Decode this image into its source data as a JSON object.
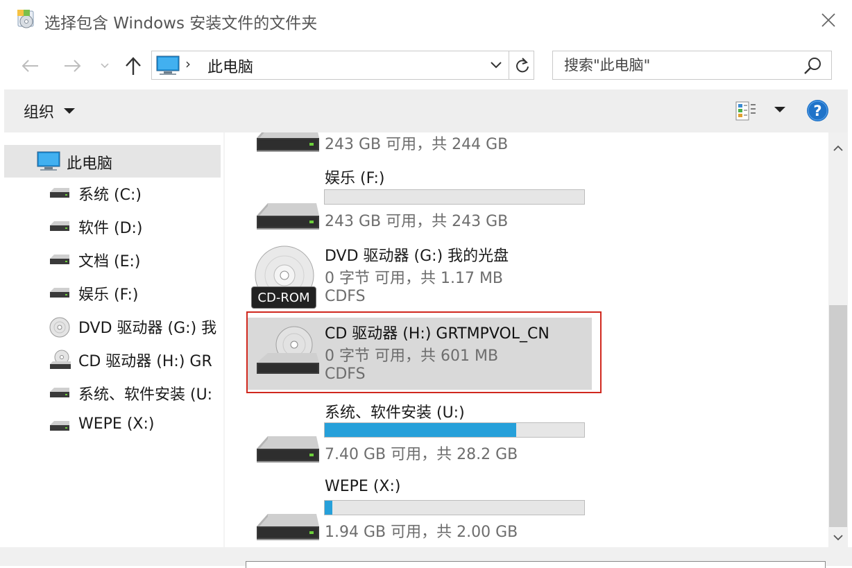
{
  "window": {
    "title": "选择包含 Windows 安装文件的文件夹"
  },
  "nav": {
    "address": "此电脑",
    "search_placeholder": "搜索\"此电脑\""
  },
  "toolbar": {
    "organize_label": "组织"
  },
  "sidebar": {
    "root_label": "此电脑",
    "items": [
      {
        "label": "系统 (C:)",
        "icon": "hard-drive-icon"
      },
      {
        "label": "软件 (D:)",
        "icon": "hard-drive-icon"
      },
      {
        "label": "文档 (E:)",
        "icon": "hard-drive-icon"
      },
      {
        "label": "娱乐 (F:)",
        "icon": "hard-drive-icon"
      },
      {
        "label": "DVD 驱动器 (G:) 我",
        "icon": "dvd-drive-icon"
      },
      {
        "label": "CD 驱动器 (H:) GR",
        "icon": "cd-drive-icon"
      },
      {
        "label": "系统、软件安装 (U:",
        "icon": "hard-drive-icon"
      },
      {
        "label": "WEPE (X:)",
        "icon": "hard-drive-icon"
      }
    ]
  },
  "drives": [
    {
      "name": "",
      "free": "243 GB 可用，共 244 GB",
      "used_fraction": 0.004
    },
    {
      "name": "娱乐 (F:)",
      "free": "243 GB 可用，共 243 GB",
      "used_fraction": 0.0
    },
    {
      "name": "DVD 驱动器 (G:) 我的光盘",
      "free": "0 字节 可用，共 1.17 MB",
      "fs": "CDFS",
      "badge": "CD-ROM"
    },
    {
      "name": "CD 驱动器 (H:) GRTMPVOL_CN",
      "free": "0 字节 可用，共 601 MB",
      "fs": "CDFS",
      "selected": true
    },
    {
      "name": "系统、软件安装 (U:)",
      "free": "7.40 GB 可用，共 28.2 GB",
      "used_fraction": 0.738
    },
    {
      "name": "WEPE (X:)",
      "free": "1.94 GB 可用，共 2.00 GB",
      "used_fraction": 0.03
    }
  ],
  "colors": {
    "accent": "#26a0da",
    "selection_outline": "#d0281e",
    "selection_bg": "#d9d9d9",
    "help": "#1f73c9"
  }
}
